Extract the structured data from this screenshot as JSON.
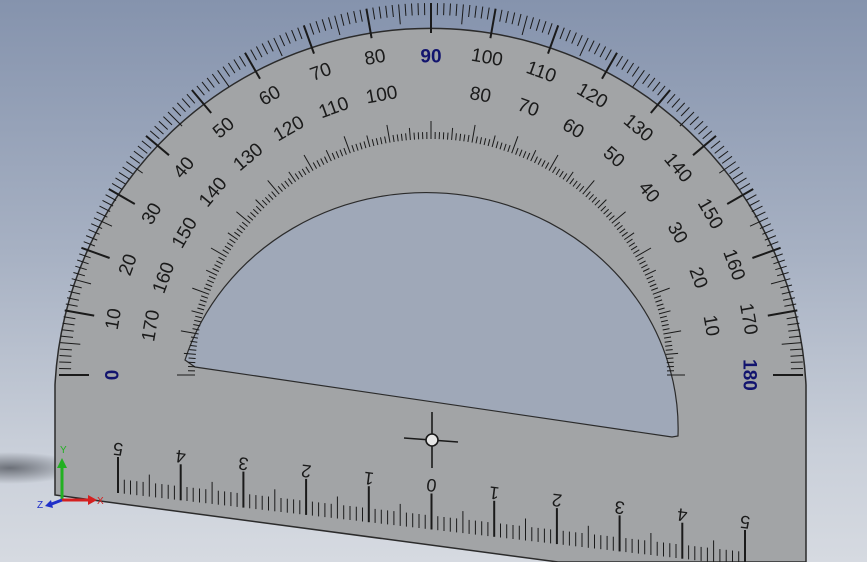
{
  "viewport": {
    "background_top": "#8593ad",
    "background_bottom": "#d6dae1",
    "part_fill": "#a2a4a6",
    "part_edge": "#2b2b2b"
  },
  "protractor": {
    "outer_scale_labels": [
      "0",
      "10",
      "20",
      "30",
      "40",
      "50",
      "60",
      "70",
      "80",
      "90",
      "100",
      "110",
      "120",
      "130",
      "140",
      "150",
      "160",
      "170",
      "180"
    ],
    "inner_scale_labels": [
      "170",
      "160",
      "150",
      "140",
      "130",
      "120",
      "110",
      "100",
      "80",
      "70",
      "60",
      "50",
      "40",
      "30",
      "20",
      "10"
    ],
    "major_label_color": "#12146e",
    "ruler_labels": [
      "5",
      "4",
      "3",
      "2",
      "1",
      "0",
      "1",
      "2",
      "3",
      "4",
      "5"
    ],
    "center_mark": "crosshair"
  },
  "triad": {
    "x_label": "X",
    "y_label": "Y",
    "z_label": "Z",
    "x_color": "#d42020",
    "y_color": "#22b022",
    "z_color": "#2030c8"
  }
}
